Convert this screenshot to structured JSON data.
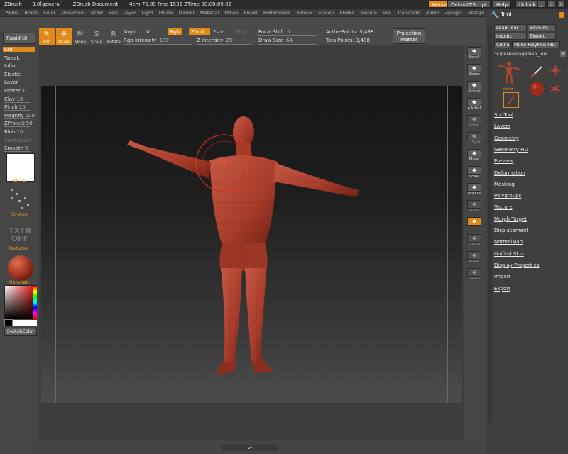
{
  "app": {
    "name": "ZBrush",
    "version": "3.0[general]",
    "document": "ZBrush Document",
    "mem": "Mem",
    "mem_value": "76.89",
    "free": "Free",
    "free_value": "1532",
    "ztime": "ZTime",
    "ztime_value": "00:00:09.02"
  },
  "titlebar_buttons": [
    "Menus",
    "DefaultZScript",
    "Help",
    "Unlock"
  ],
  "window_buttons": [
    "_",
    "↕",
    "▫",
    "×"
  ],
  "menu_items": [
    "Alpha",
    "Brush",
    "Color",
    "Document",
    "Draw",
    "Edit",
    "Layer",
    "Light",
    "Macro",
    "Marker",
    "Material",
    "Movie",
    "Picker",
    "Preferences",
    "Render",
    "Stencil",
    "Stroke",
    "Texture",
    "Tool",
    "Transform",
    "Zoom",
    "Zplugin",
    "Zscript"
  ],
  "toolbar": {
    "edit": "Edit",
    "draw": "Draw",
    "move": "Move",
    "scale": "Scale",
    "rotate": "Rotate",
    "mrgb": "Mrgb",
    "m": "M",
    "rgb": "Rgb",
    "zadd": "Zadd",
    "zsub": "Zsub",
    "zcut": "Zcut",
    "rgb_intensity_label": "Rgb Intensity",
    "rgb_intensity_value": "100",
    "z_intensity_label": "Z Intensity",
    "z_intensity_value": "25",
    "focal_shift_label": "Focal Shift",
    "focal_shift_value": "0",
    "draw_size_label": "Draw Size",
    "draw_size_value": "64",
    "active_points_label": "ActivePoints:",
    "active_points_value": "3,498",
    "total_points_label": "TotalPoints:",
    "total_points_value": "3,498",
    "projection_master": "Projection Master"
  },
  "left_panel": {
    "rapid_ui": "Rapid UI",
    "brushes": [
      {
        "label": "Std",
        "value": "",
        "selected": true
      },
      {
        "label": "Tweak",
        "value": ""
      },
      {
        "label": "Inflat",
        "value": ""
      },
      {
        "label": "Elastic",
        "value": ""
      },
      {
        "label": "Layer",
        "value": ""
      },
      {
        "label": "Flatten",
        "value": "0"
      },
      {
        "label": "Clay",
        "value": "10"
      },
      {
        "label": "Pinch",
        "value": "10"
      },
      {
        "label": "Magnify",
        "value": "100"
      },
      {
        "label": "ZProject",
        "value": "50"
      },
      {
        "label": "Blob",
        "value": "10"
      },
      {
        "label": "Snakehook",
        "value": ""
      },
      {
        "label": "Smooth",
        "value": "0"
      }
    ],
    "alpha_label": "Alpha",
    "stroke_label": "Stroke",
    "texture_icon_text": "TXTR OFF",
    "texture_label": "Texture",
    "material_label": "Material",
    "switch_color": "SwitchColor"
  },
  "right_shelf": [
    {
      "label": "Scroll",
      "icon": "hand-icon"
    },
    {
      "label": "Zoom",
      "icon": "magnifier-icon"
    },
    {
      "label": "Actual",
      "icon": "actual-size-icon"
    },
    {
      "label": "AAHalf",
      "icon": "aahalf-icon"
    },
    {
      "label": "Local",
      "icon": "local-icon",
      "dim": true
    },
    {
      "label": "L.Sym",
      "icon": "lsym-icon",
      "dim": true
    },
    {
      "label": "Move",
      "icon": "move-icon"
    },
    {
      "label": "Scale",
      "icon": "scale-icon"
    },
    {
      "label": "Rotate",
      "icon": "rotate-icon"
    },
    {
      "label": "Qxyz",
      "icon": "xyz-icon",
      "dim": true
    },
    {
      "label": "",
      "icon": "orange-axis-icon",
      "orange": true
    },
    {
      "label": "Frame",
      "icon": "frame-icon",
      "dim": true
    },
    {
      "label": "Move",
      "icon": "move-dim-icon",
      "dim": true
    },
    {
      "label": "Lasso",
      "icon": "lasso-icon",
      "dim": true
    }
  ],
  "tool_panel": {
    "title": "Tool",
    "load_tool": "Load Tool",
    "save_as": "Save As",
    "import": "Import",
    "export": "Export",
    "clone": "Clone",
    "make_polymesh": "Make PolyMesh3D",
    "current_tool": "SuperAverageMan_low",
    "r_button": "R",
    "tool_caption": "Tool",
    "subpalettes": [
      "SubTool",
      "Layers",
      "Geometry",
      "Geometry HD",
      "Preview",
      "Deformation",
      "Masking",
      "Polygroups",
      "Texture",
      "Morph Target",
      "Displacement",
      "NormalMap",
      "Unified Skin",
      "Display Properties",
      "Import",
      "Export"
    ]
  },
  "colors": {
    "accent": "#e08a1a",
    "model": "#b24532",
    "panel": "#454545"
  }
}
